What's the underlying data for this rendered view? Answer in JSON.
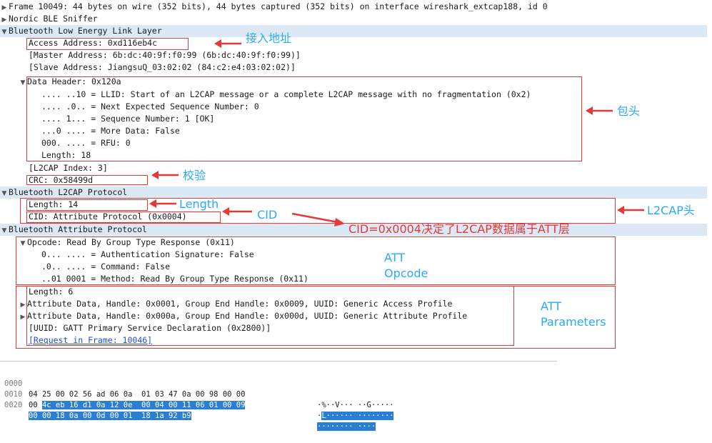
{
  "packet_tree": {
    "frame": "Frame 10049: 44 bytes on wire (352 bits), 44 bytes captured (352 bits) on interface wireshark_extcap188, id 0",
    "nordic": "Nordic BLE Sniffer",
    "btle": "Bluetooth Low Energy Link Layer",
    "access_address": "Access Address: 0xd116eb4c",
    "master_address": "[Master Address: 6b:dc:40:9f:f0:99 (6b:dc:40:9f:f0:99)]",
    "slave_address": "[Slave Address: JiangsuQ_03:02:02 (84:c2:e4:03:02:02)]",
    "data_header": "Data Header: 0x120a",
    "llid": ".... ..10 = LLID: Start of an L2CAP message or a complete L2CAP message with no fragmentation (0x2)",
    "nesn": ".... .0.. = Next Expected Sequence Number: 0",
    "sn": ".... 1... = Sequence Number: 1 [OK]",
    "md": "...0 .... = More Data: False",
    "rfu": "000. .... = RFU: 0",
    "header_length": "Length: 18",
    "l2cap_index": "[L2CAP Index: 3]",
    "crc": "CRC: 0x58499d",
    "l2cap": "Bluetooth L2CAP Protocol",
    "l2cap_length": "Length: 14",
    "cid": "CID: Attribute Protocol (0x0004)",
    "att": "Bluetooth Attribute Protocol",
    "opcode": "Opcode: Read By Group Type Response (0x11)",
    "auth_sig": "0... .... = Authentication Signature: False",
    "command": ".0.. .... = Command: False",
    "method": "..01 0001 = Method: Read By Group Type Response (0x11)",
    "att_length": "Length: 6",
    "attr_data_1": "Attribute Data, Handle: 0x0001, Group End Handle: 0x0009, UUID: Generic Access Profile",
    "attr_data_2": "Attribute Data, Handle: 0x000a, Group End Handle: 0x000d, UUID: Generic Attribute Profile",
    "uuid": "[UUID: GATT Primary Service Declaration (0x2800)]",
    "request_in_frame": "[Request in Frame: 10046]"
  },
  "annotations": {
    "access_address": "接入地址",
    "header": "包头",
    "crc": "校验",
    "length": "Length",
    "cid": "CID",
    "l2cap_head": "L2CAP头",
    "cid_note": "CID=0x0004决定了L2CAP数据属于ATT层",
    "att_opcode": "ATT\nOpcode",
    "att_params": "ATT\nParameters"
  },
  "hex_dump": {
    "rows": [
      {
        "offset": "0000",
        "plain": "04 25 00 02 56 ad 06 0a  01 03 47 0a 00 98 00 00",
        "sel": "",
        "ascii_plain": "·%··V··· ··G·····",
        "ascii_sel": ""
      },
      {
        "offset": "0010",
        "plain": "00 ",
        "sel": "4c eb 16 d1 0a 12 0e  00 04 00 11 06 01 00 09",
        "ascii_plain": "·",
        "ascii_sel": "L······ ········"
      },
      {
        "offset": "0020",
        "plain": "",
        "sel": "00 00 18 0a 00 0d 00 01  18 1a 92 b9",
        "ascii_plain": "",
        "ascii_sel": "········ ····"
      }
    ]
  },
  "colors": {
    "annotation_box": "#e53935",
    "annotation_text": "#2aa8ff",
    "selection": "#2a7fd4"
  }
}
